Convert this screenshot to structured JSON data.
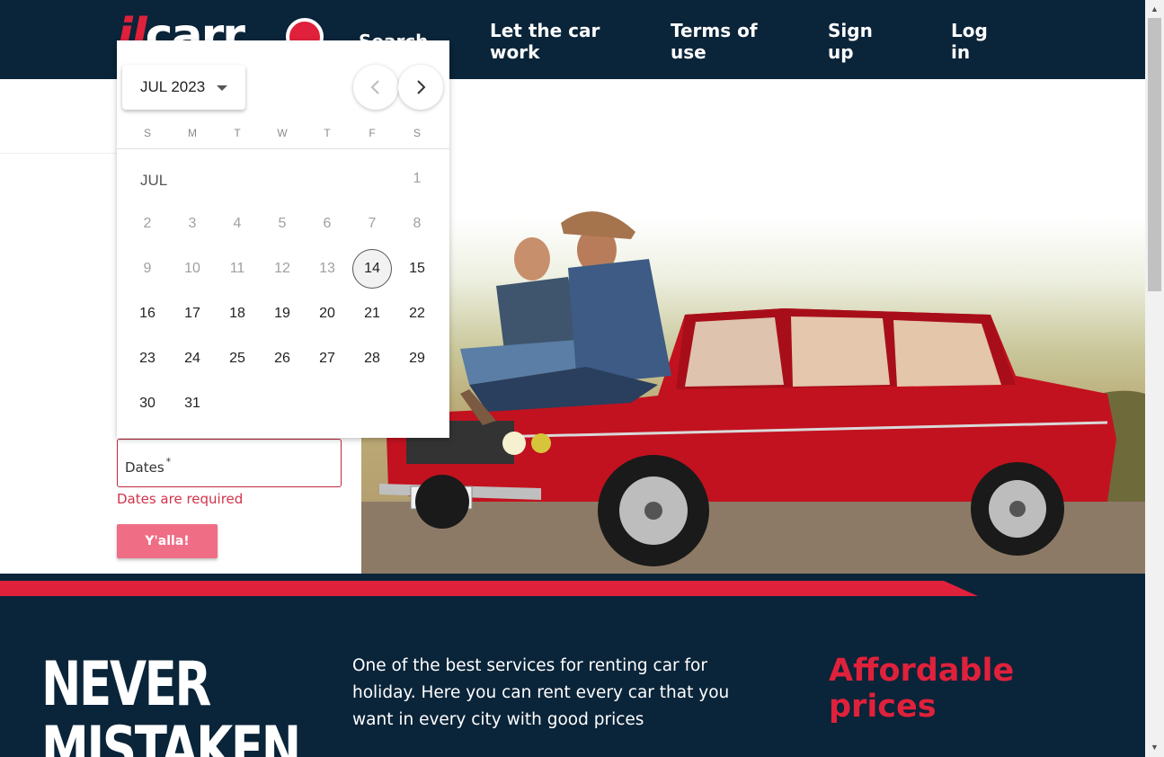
{
  "header": {
    "logo_text": "ilcarro",
    "nav": [
      "Search",
      [
        "Let the car",
        "work"
      ],
      [
        "Terms of",
        "use"
      ],
      [
        "Sign",
        "up"
      ],
      [
        "Log",
        "in"
      ]
    ]
  },
  "form": {
    "dates_label": "Dates",
    "required_mark": "*",
    "dates_error": "Dates are required",
    "submit_label": "Y'alla!"
  },
  "datepicker": {
    "period_label": "JUL 2023",
    "weekdays": [
      "S",
      "M",
      "T",
      "W",
      "T",
      "F",
      "S"
    ],
    "month_label": "JUL",
    "first_weekday_index": 6,
    "days_in_month": 31,
    "today": 14,
    "disabled_before": 14
  },
  "bottom": {
    "headline": [
      "NEVER",
      "MISTAKEN"
    ],
    "description": "One of the best services for renting car for holiday. Here you can rent every car that you want in every city with good prices",
    "feature_title": [
      "Affordable",
      "prices"
    ]
  },
  "colors": {
    "navy": "#0a2439",
    "accent_red": "#e0213b",
    "button_pink": "#f06d86"
  }
}
